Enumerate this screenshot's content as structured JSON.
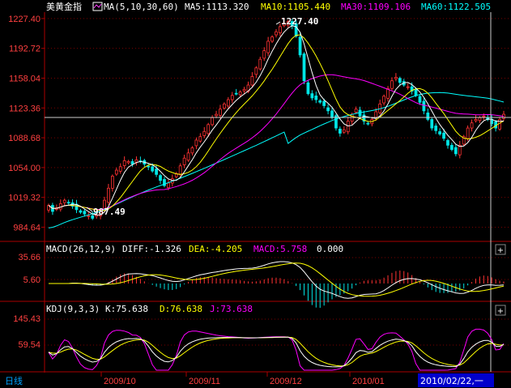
{
  "colors": {
    "background": "#000000",
    "up": "#ff3232",
    "down": "#00e5e5",
    "ma5": "#ffffff",
    "ma10": "#ffff00",
    "ma30": "#ff00ff",
    "ma60": "#00ffff",
    "axis": "#aa0000",
    "axis_text": "#ff4040",
    "grid": "#7a0000"
  },
  "main": {
    "instrument": "美黄金指",
    "ma_params": "MA(5,10,30,60)",
    "ma5": "MA5:1113.320",
    "ma10": "MA10:1105.440",
    "ma30": "MA30:1109.106",
    "ma60": "MA60:1122.505",
    "high_annotation": "1227.40",
    "low_annotation": "987.49",
    "y_ticks": [
      "1227.40",
      "1192.72",
      "1158.04",
      "1123.36",
      "1088.68",
      "1054.00",
      "1019.32",
      "984.64"
    ]
  },
  "macd": {
    "label": "MACD(26,12,9)",
    "diff": "DIFF:-1.326",
    "dea": "DEA:-4.205",
    "macd": "MACD:5.758",
    "extra": "0.000",
    "y_ticks": [
      "35.66",
      "5.60"
    ]
  },
  "kdj": {
    "label": "KDJ(9,3,3)",
    "k": "K:75.638",
    "d": "D:76.638",
    "j": "J:73.638",
    "y_ticks": [
      "145.43",
      "59.54"
    ]
  },
  "bottom": {
    "period": "日线",
    "months": [
      "2009/10",
      "2009/11",
      "2009/12",
      "2010/01"
    ],
    "cursor_date": "2010/02/22,一"
  },
  "chart_data": {
    "type": "candlestick",
    "title": "美黄金指",
    "ylim": [
      970,
      1232
    ],
    "closes": [
      1010,
      1003,
      1007,
      1012,
      1016,
      1013,
      1009,
      1005,
      1002,
      1000,
      998,
      995,
      999,
      1003,
      1016,
      1030,
      1044,
      1051,
      1055,
      1062,
      1061,
      1058,
      1063,
      1061,
      1058,
      1055,
      1050,
      1046,
      1039,
      1033,
      1036,
      1041,
      1047,
      1056,
      1065,
      1071,
      1077,
      1086,
      1090,
      1096,
      1104,
      1112,
      1116,
      1122,
      1128,
      1133,
      1138,
      1140,
      1142,
      1145,
      1150,
      1160,
      1170,
      1180,
      1190,
      1201,
      1206,
      1212,
      1218,
      1222,
      1224,
      1219,
      1207,
      1185,
      1155,
      1140,
      1135,
      1133,
      1130,
      1126,
      1120,
      1112,
      1100,
      1094,
      1098,
      1108,
      1116,
      1122,
      1114,
      1108,
      1105,
      1110,
      1119,
      1128,
      1137,
      1146,
      1155,
      1159,
      1153,
      1150,
      1148,
      1143,
      1138,
      1130,
      1120,
      1110,
      1100,
      1097,
      1093,
      1088,
      1080,
      1075,
      1070,
      1080,
      1090,
      1100,
      1106,
      1110,
      1112,
      1114,
      1110,
      1105,
      1100,
      1110,
      1116
    ],
    "ma5_at_cursor": 1113.32,
    "ma10_at_cursor": 1105.44,
    "ma30_at_cursor": 1109.106,
    "ma60_at_cursor": 1122.505,
    "high": 1227.4,
    "low": 987.49
  }
}
